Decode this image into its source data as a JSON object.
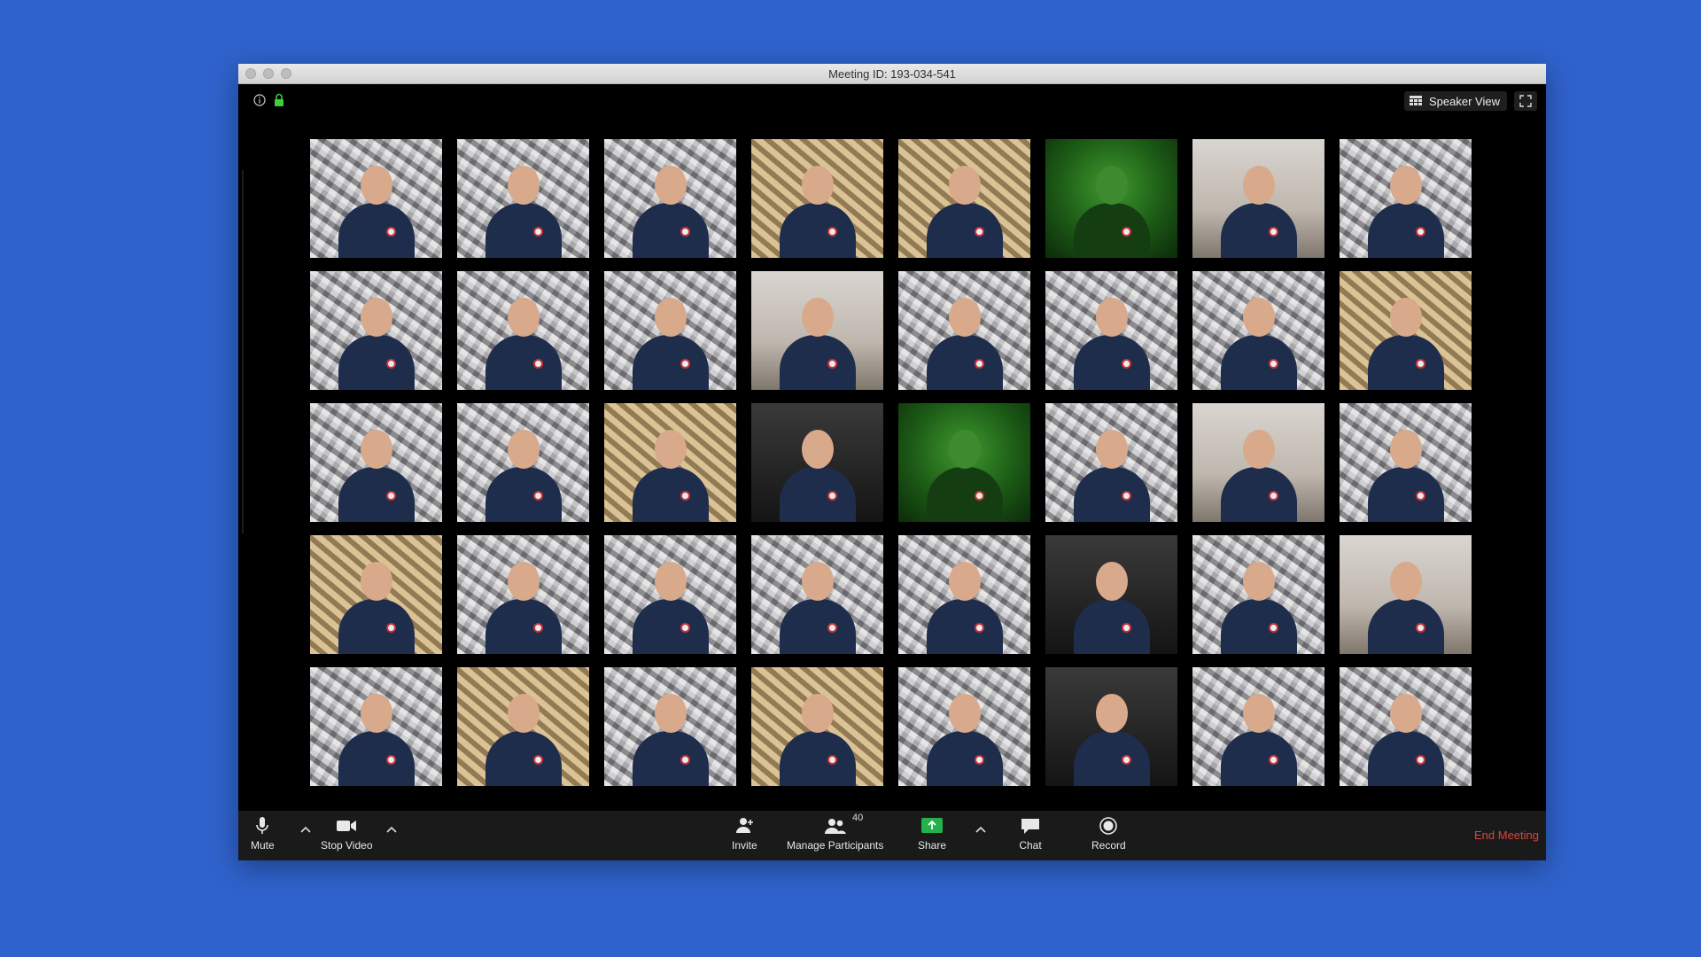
{
  "window": {
    "title": "Meeting ID: 193-034-541"
  },
  "header": {
    "speaker_view_label": "Speaker View"
  },
  "gallery": {
    "tiles": [
      {
        "style": "foil"
      },
      {
        "style": "foil"
      },
      {
        "style": "foil"
      },
      {
        "style": "warm"
      },
      {
        "style": "warm"
      },
      {
        "style": "green"
      },
      {
        "style": "room"
      },
      {
        "style": "foil"
      },
      {
        "style": "foil"
      },
      {
        "style": "foil"
      },
      {
        "style": "foil"
      },
      {
        "style": "room"
      },
      {
        "style": "foil"
      },
      {
        "style": "foil"
      },
      {
        "style": "foil"
      },
      {
        "style": "warm"
      },
      {
        "style": "foil"
      },
      {
        "style": "foil"
      },
      {
        "style": "warm"
      },
      {
        "style": "dark"
      },
      {
        "style": "green"
      },
      {
        "style": "foil"
      },
      {
        "style": "room"
      },
      {
        "style": "foil"
      },
      {
        "style": "warm"
      },
      {
        "style": "foil"
      },
      {
        "style": "foil"
      },
      {
        "style": "foil"
      },
      {
        "style": "foil"
      },
      {
        "style": "dark"
      },
      {
        "style": "foil"
      },
      {
        "style": "room"
      },
      {
        "style": "foil"
      },
      {
        "style": "warm"
      },
      {
        "style": "foil"
      },
      {
        "style": "warm"
      },
      {
        "style": "foil"
      },
      {
        "style": "dark"
      },
      {
        "style": "foil"
      },
      {
        "style": "foil"
      }
    ]
  },
  "toolbar": {
    "mute_label": "Mute",
    "stop_video_label": "Stop Video",
    "invite_label": "Invite",
    "manage_participants_label": "Manage Participants",
    "participants_count": "40",
    "share_label": "Share",
    "chat_label": "Chat",
    "record_label": "Record",
    "end_meeting_label": "End Meeting"
  },
  "colors": {
    "background": "#2f62cc",
    "share_green": "#22b14c",
    "end_meeting_red": "#e0423a"
  }
}
